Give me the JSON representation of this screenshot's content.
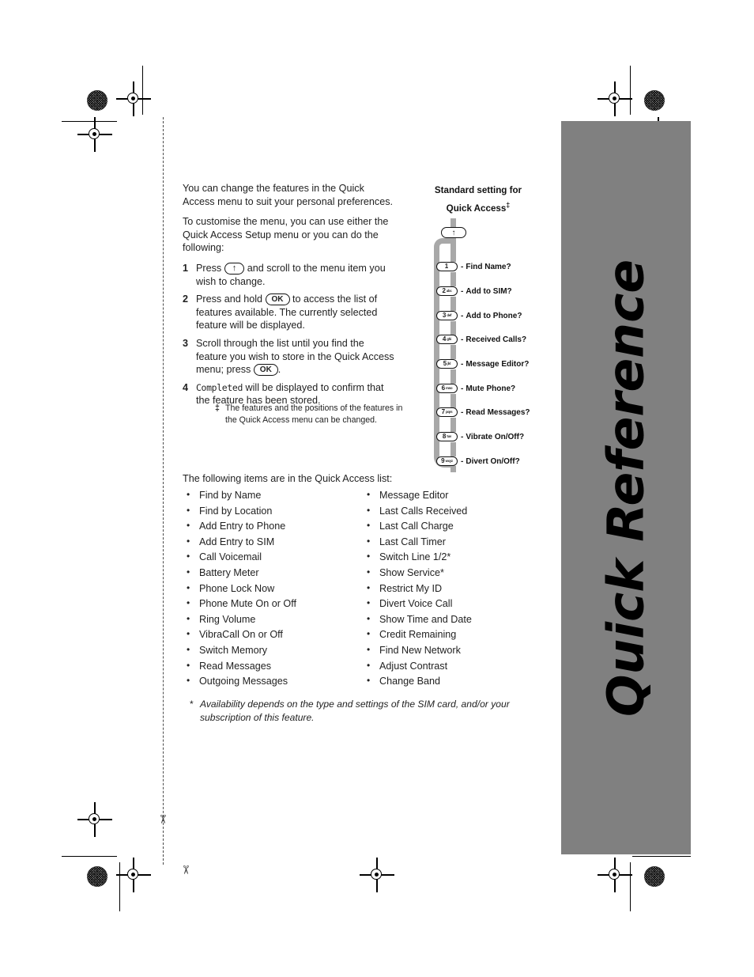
{
  "tab": {
    "title": "Quick Reference",
    "bg_color": "#808080"
  },
  "body": {
    "intro_1": "You can change the features in the Quick Access menu to suit your personal preferences.",
    "intro_2": "To customise the menu, you can use either the Quick Access Setup menu or you can do the following:",
    "steps": [
      {
        "num": "1",
        "before": "Press",
        "key": "↑",
        "after": "and scroll to the menu item you wish to change."
      },
      {
        "num": "2",
        "before": "Press and hold",
        "key": "OK",
        "after": "to access the list of features available. The currently selected feature will be displayed."
      },
      {
        "num": "3",
        "before": "Scroll through the list until you find the feature you wish to store in the Quick Access menu; press",
        "key": "OK",
        "after": "."
      },
      {
        "num": "4",
        "lcd": "Completed",
        "after": "will be displayed to confirm that the feature has been stored."
      }
    ]
  },
  "dagger_note": {
    "mark": "‡",
    "text": "The features and the positions of the features in the Quick Access menu can be changed."
  },
  "diagram": {
    "heading_line1": "Standard setting for",
    "heading_line2": "Quick Access",
    "heading_mark": "‡",
    "scroll_key": "↑",
    "items": [
      {
        "key_num": "1",
        "key_letters": "",
        "label": "Find Name?"
      },
      {
        "key_num": "2",
        "key_letters": "abc",
        "label": "Add to SIM?"
      },
      {
        "key_num": "3",
        "key_letters": "def",
        "label": "Add to Phone?"
      },
      {
        "key_num": "4",
        "key_letters": "ghi",
        "label": "Received Calls?"
      },
      {
        "key_num": "5",
        "key_letters": "jkl",
        "label": "Message Editor?"
      },
      {
        "key_num": "6",
        "key_letters": "mno",
        "label": "Mute Phone?"
      },
      {
        "key_num": "7",
        "key_letters": "pqrs",
        "label": "Read Messages?"
      },
      {
        "key_num": "8",
        "key_letters": "tuv",
        "label": "Vibrate On/Off?"
      },
      {
        "key_num": "9",
        "key_letters": "wxyz",
        "label": "Divert On/Off?"
      }
    ],
    "dash": "-",
    "track_color": "#a8a8a8"
  },
  "features": {
    "intro": "The following items are in the Quick Access list:",
    "left": [
      "Find by Name",
      "Find by Location",
      "Add Entry to Phone",
      "Add Entry to SIM",
      "Call Voicemail",
      "Battery Meter",
      "Phone Lock Now",
      "Phone Mute On or Off",
      "Ring Volume",
      "VibraCall On or Off",
      "Switch Memory",
      "Read Messages",
      "Outgoing Messages"
    ],
    "right": [
      "Message Editor",
      "Last Calls Received",
      "Last Call Charge",
      "Last Call Timer",
      "Switch Line 1/2*",
      "Show Service*",
      "Restrict My ID",
      "Divert Voice Call",
      "Show Time and Date",
      "Credit Remaining",
      "Find New Network",
      "Adjust Contrast",
      "Change Band"
    ]
  },
  "star_note": {
    "mark": "*",
    "text": "Availability depends on the type and settings of the SIM card, and/or your subscription of this feature."
  }
}
